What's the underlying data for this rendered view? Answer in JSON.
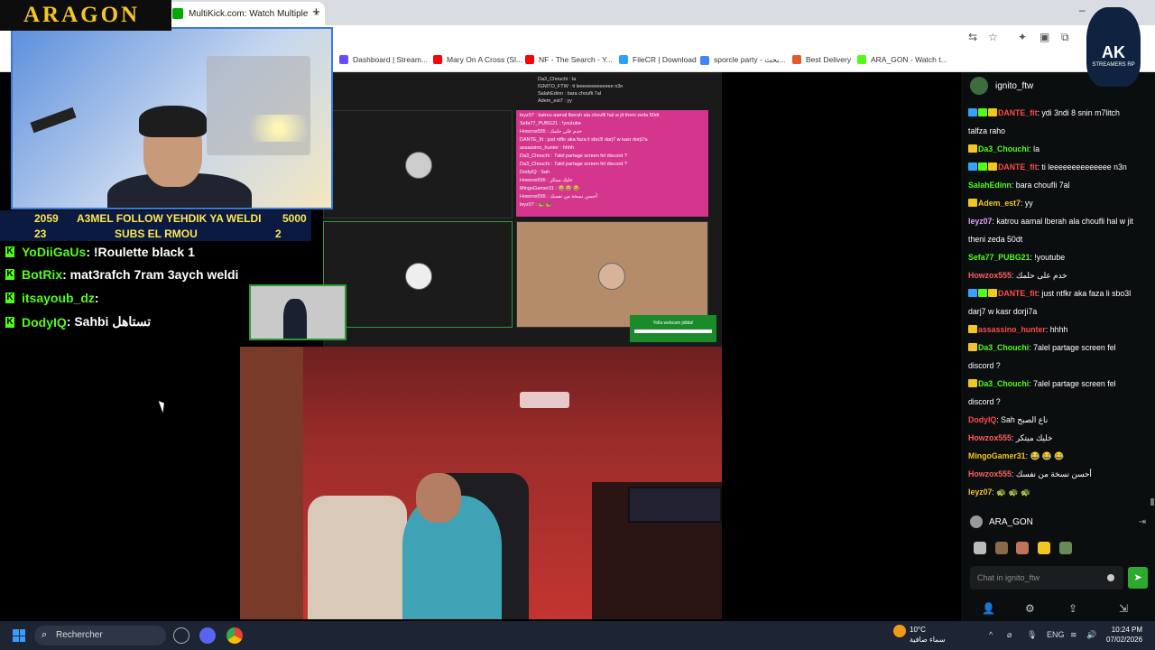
{
  "browser": {
    "tab_title": "MultiKick.com: Watch Multiple",
    "tab_close": "×",
    "new_tab": "+",
    "window_min": "–",
    "bookmarks": [
      {
        "label": "Dashboard | Stream...",
        "color": "#6a4cff"
      },
      {
        "label": "Mary On A Cross (Sl...",
        "color": "#ff0000"
      },
      {
        "label": "NF - The Search - Y...",
        "color": "#ff0000"
      },
      {
        "label": "FileCR | Download",
        "color": "#29a3ff"
      },
      {
        "label": "sporcle party - بحث...",
        "color": "#4285f4"
      },
      {
        "label": "Best Delivery",
        "color": "#e05a2a"
      },
      {
        "label": "ARA_GON - Watch t...",
        "color": "#53fc18"
      }
    ]
  },
  "overlay": {
    "logo": "ARAGON",
    "goal1": {
      "left": "2059",
      "text": "A3MEL FOLLOW YEHDIK YA WELDI",
      "right": "5000"
    },
    "goal2": {
      "left": "23",
      "text": "SUBS EL RMOU",
      "right": "2"
    },
    "chat": [
      {
        "user": "YoDiiGaUs",
        "msg": " : !Roulette black 1"
      },
      {
        "user": "BotRix",
        "msg": " : mat3rafch 7ram 3aych weldi"
      },
      {
        "user": "itsayoub_dz",
        "msg": " : "
      },
      {
        "user": "DodyIQ",
        "msg": " : Sahbi تستاهل"
      }
    ]
  },
  "vc": {
    "top_chat": [
      "Da3_Chouchi : la",
      "IGNITO_FTW : ti leeeeeeeeeeeee n3n",
      "SalahEdinn : bara choufli 7al",
      "Adem_est7 : yy"
    ],
    "pink_chat": [
      "leyz07 : katrou aamal lberah ala choufli hal w jit theni zeda 50dt",
      "Sefa77_PUBG21 : !youtube",
      "Howzox555 : خدم على حلمك",
      "DANTE_fit : just ntfkr aka faza li sbo3l darj7 w kasr dorji7a",
      "assassino_hunter : hhhh",
      "Da3_Chouchi : 7alel partage screen fel discord ?",
      "Da3_Chouchi : 7alel partage screen fel discord ?",
      "DodyIQ : Sah",
      "Howzox555 : خليك ميتكر",
      "MingoGamer31 : 😂 😂 😂",
      "Howzox555 : أحسن نسخة من نفسك",
      "leyz07 : 🐢 🐢"
    ],
    "webcam_popup": "Yolla webcam jidida!"
  },
  "kick_chat": {
    "channel": "ignito_ftw",
    "lines": [
      {
        "user": "DANTE_fit",
        "uclass": "r",
        "msg": "ydi 3ndi 8 snin m7litch",
        "badges": 3
      },
      {
        "user": "",
        "uclass": "w",
        "msg": "talfza raho",
        "badges": 0
      },
      {
        "user": "Da3_Chouchi",
        "uclass": "g",
        "msg": "la",
        "badges": 1
      },
      {
        "user": "DANTE_fit",
        "uclass": "r",
        "msg": "ti leeeeeeeeeeeeee n3n",
        "badges": 3
      },
      {
        "user": "SalahEdinn",
        "uclass": "g",
        "msg": "bara choufli 7al",
        "badges": 0
      },
      {
        "user": "Adem_est7",
        "uclass": "y",
        "msg": "yy",
        "badges": 1
      },
      {
        "user": "leyz07",
        "uclass": "p",
        "msg": "katrou aamal lberah ala choufli hal w jit",
        "badges": 0
      },
      {
        "user": "",
        "uclass": "w",
        "msg": "theni zeda 50dt",
        "badges": 0
      },
      {
        "user": "Sefa77_PUBG21",
        "uclass": "g",
        "msg": "!youtube",
        "badges": 0
      },
      {
        "user": "Howzox555",
        "uclass": "o",
        "msg": "خدم على حلمك",
        "badges": 0
      },
      {
        "user": "DANTE_fit",
        "uclass": "r",
        "msg": "just ntfkr aka faza li sbo3l",
        "badges": 3
      },
      {
        "user": "",
        "uclass": "w",
        "msg": "darj7 w kasr dorji7a",
        "badges": 0
      },
      {
        "user": "assassino_hunter",
        "uclass": "r",
        "msg": "hhhh",
        "badges": 1
      },
      {
        "user": "Da3_Chouchi",
        "uclass": "g",
        "msg": "7alel partage screen fel",
        "badges": 1
      },
      {
        "user": "",
        "uclass": "w",
        "msg": "discord ?",
        "badges": 0
      },
      {
        "user": "Da3_Chouchi",
        "uclass": "g",
        "msg": "7alel partage screen fel",
        "badges": 1
      },
      {
        "user": "",
        "uclass": "w",
        "msg": "discord ?",
        "badges": 0
      },
      {
        "user": "DodyIQ",
        "uclass": "r",
        "msg": "Sah ناع الصبح",
        "badges": 0
      },
      {
        "user": "Howzox555",
        "uclass": "o",
        "msg": "خليك ميتكر",
        "badges": 0
      },
      {
        "user": "MingoGamer31",
        "uclass": "y",
        "msg": "😂 😂 😂",
        "badges": 0
      },
      {
        "user": "Howzox555",
        "uclass": "o",
        "msg": "أحسن نسخة من نفسك",
        "badges": 0
      },
      {
        "user": "leyz07",
        "uclass": "y",
        "msg": "🐢 🐢 🐢",
        "badges": 0
      }
    ],
    "me": "ARA_GON",
    "input_placeholder": "Chat in ignito_ftw"
  },
  "ak_badge": {
    "title": "AK",
    "sub": "STREAMERS RP"
  },
  "taskbar": {
    "search": "Rechercher",
    "temp": "10°C",
    "condition": "سماء صافية",
    "lang": "ENG",
    "time": "10:24 PM",
    "date": "07/02/2026"
  },
  "colors": {
    "kick_green": "#53fc18",
    "goal_bg": "#0b1a40",
    "goal_text": "#ffe650",
    "pink": "#d4368e"
  }
}
